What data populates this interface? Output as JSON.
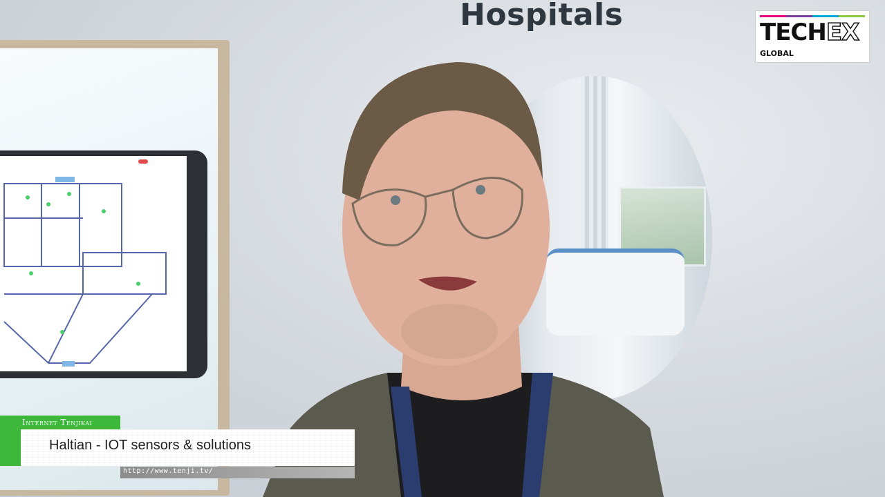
{
  "backdrop": {
    "title": "Hospitals"
  },
  "logo": {
    "brand_main": "TECH",
    "brand_accent": "EX",
    "subtitle": "GLOBAL"
  },
  "lower_third": {
    "channel": "Internet Tenjikai",
    "caption": "Haltian - IOT sensors & solutions",
    "url": "http://www.tenji.tv/"
  },
  "colors": {
    "accent_green": "#3db83a",
    "lanyard": "#2a3d6e",
    "jacket": "#5b5a4e"
  }
}
